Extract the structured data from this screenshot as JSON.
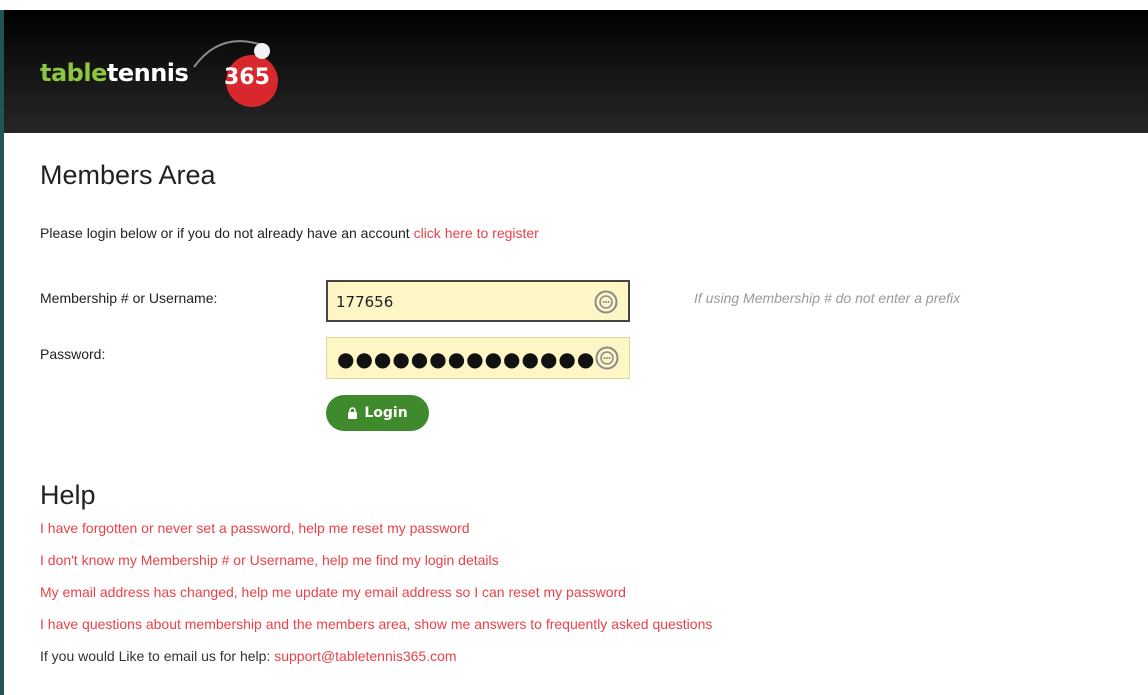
{
  "header": {
    "logo": {
      "part1": "table",
      "part2": "tennis",
      "number": "365"
    }
  },
  "main": {
    "title": "Members Area",
    "intro_text": "Please login below or if you do not already have an account ",
    "register_link": "click here to register"
  },
  "login_form": {
    "username_label": "Membership # or Username:",
    "username_value": "177656",
    "password_label": "Password:",
    "password_masked": "●●●●●●●●●●●●●●",
    "hint": "If using Membership # do not enter a prefix",
    "login_button": "Login"
  },
  "help": {
    "title": "Help",
    "links": [
      "I have forgotten or never set a password, help me reset my password",
      "I don't know my Membership # or Username, help me find my login details",
      "My email address has changed, help me update my email address so I can reset my password",
      "I have questions about membership and the members area, show me answers to frequently asked questions"
    ],
    "email_prompt": "If you would Like to email us for help: ",
    "email": "support@tabletennis365.com"
  },
  "colors": {
    "link": "#e8424a",
    "logo_green": "#8dc63f",
    "logo_red": "#d9272e",
    "button_green": "#3e8a2c",
    "field_background": "#fef6c5"
  }
}
